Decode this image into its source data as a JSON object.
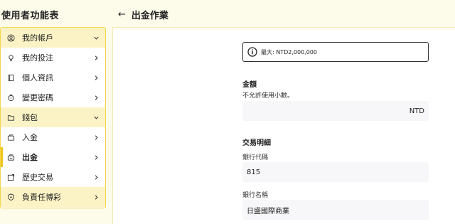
{
  "sidebar": {
    "title": "使用者功能表",
    "items": [
      {
        "label": "我的帳戶",
        "icon": "user-circle-icon",
        "chevron": "down",
        "group": true
      },
      {
        "label": "我的投注",
        "icon": "bulb-icon",
        "chevron": "right"
      },
      {
        "label": "個人資訊",
        "icon": "book-icon",
        "chevron": "right"
      },
      {
        "label": "變更密碼",
        "icon": "lock-icon",
        "chevron": "right"
      },
      {
        "label": "錢包",
        "icon": "folder-icon",
        "chevron": "down",
        "group": true
      },
      {
        "label": "入金",
        "icon": "wallet-in-icon",
        "chevron": "right"
      },
      {
        "label": "出金",
        "icon": "wallet-out-icon",
        "chevron": "right",
        "active": true
      },
      {
        "label": "歷史交易",
        "icon": "history-icon",
        "chevron": "right"
      },
      {
        "label": "負責任博彩",
        "icon": "shield-icon",
        "chevron": "right",
        "group": true
      }
    ]
  },
  "header": {
    "back_icon": "arrow-left-icon",
    "title": "出金作業"
  },
  "notice": {
    "text": "最大: NTD2,000,000"
  },
  "amount": {
    "section_title": "金額",
    "hint": "不允許使用小數。",
    "value": "",
    "unit": "NTD"
  },
  "transaction": {
    "section_title": "交易明細",
    "bank_code_label": "銀行代碼",
    "bank_code_value": "815",
    "bank_name_label": "銀行名稱",
    "bank_name_value": "日盛國際商業"
  },
  "colors": {
    "accent": "#f3d54a",
    "page_bg": "#fdfbea",
    "group_bg": "#fbf3c6"
  }
}
